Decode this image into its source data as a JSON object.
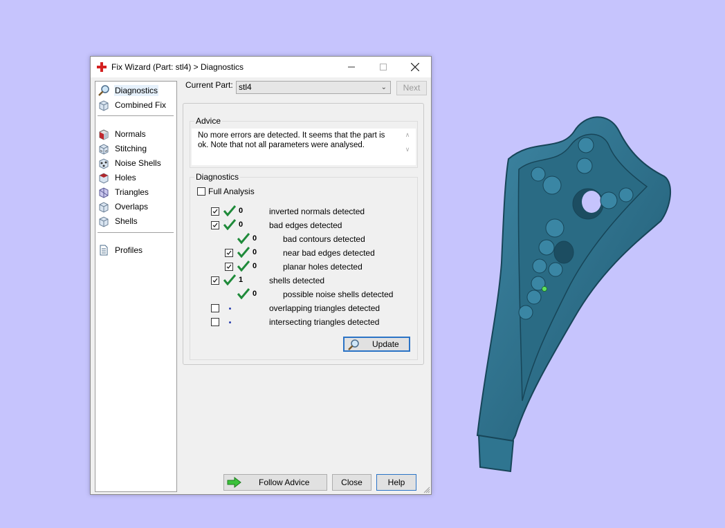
{
  "window": {
    "title": "Fix Wizard (Part: stl4) > Diagnostics"
  },
  "nav": {
    "items": [
      {
        "label": "Diagnostics",
        "icon": "diagnostics-icon"
      },
      {
        "label": "Combined Fix",
        "icon": "combined-fix-icon"
      },
      {
        "label": "Normals",
        "icon": "normals-icon"
      },
      {
        "label": "Stitching",
        "icon": "stitching-icon"
      },
      {
        "label": "Noise Shells",
        "icon": "noise-shells-icon"
      },
      {
        "label": "Holes",
        "icon": "holes-icon"
      },
      {
        "label": "Triangles",
        "icon": "triangles-icon"
      },
      {
        "label": "Overlaps",
        "icon": "overlaps-icon"
      },
      {
        "label": "Shells",
        "icon": "shells-icon"
      },
      {
        "label": "Profiles",
        "icon": "profiles-icon"
      }
    ],
    "selected": "Diagnostics"
  },
  "current_part": {
    "label": "Current Part:",
    "value": "stl4"
  },
  "next_label": "Next",
  "advice": {
    "title": "Advice",
    "text": "No more errors are detected. It seems that the part is ok. Note that not all parameters were analysed."
  },
  "diagnostics": {
    "title": "Diagnostics",
    "full_analysis": {
      "label": "Full Analysis",
      "checked": false
    },
    "rows": [
      {
        "checked": true,
        "status": "ok",
        "count": "0",
        "label": "inverted normals detected"
      },
      {
        "checked": true,
        "status": "ok",
        "count": "0",
        "label": "bad edges detected"
      },
      {
        "checked": null,
        "status": "ok",
        "count": "0",
        "label": "bad contours detected"
      },
      {
        "checked": true,
        "status": "ok",
        "count": "0",
        "label": "near bad edges detected"
      },
      {
        "checked": true,
        "status": "ok",
        "count": "0",
        "label": "planar holes detected"
      },
      {
        "checked": true,
        "status": "ok",
        "count": "1",
        "label": "shells detected"
      },
      {
        "checked": null,
        "status": "ok",
        "count": "0",
        "label": "possible noise shells detected"
      },
      {
        "checked": false,
        "status": "pending",
        "count": "",
        "label": "overlapping triangles detected"
      },
      {
        "checked": false,
        "status": "pending",
        "count": "",
        "label": "intersecting triangles detected"
      }
    ],
    "update_label": "Update"
  },
  "buttons": {
    "follow_advice": "Follow Advice",
    "close": "Close",
    "help": "Help"
  },
  "colors": {
    "background": "#c6c4fd",
    "model": "#2f7590",
    "check": "#1f8a3a",
    "accent": "#2a73c6"
  }
}
